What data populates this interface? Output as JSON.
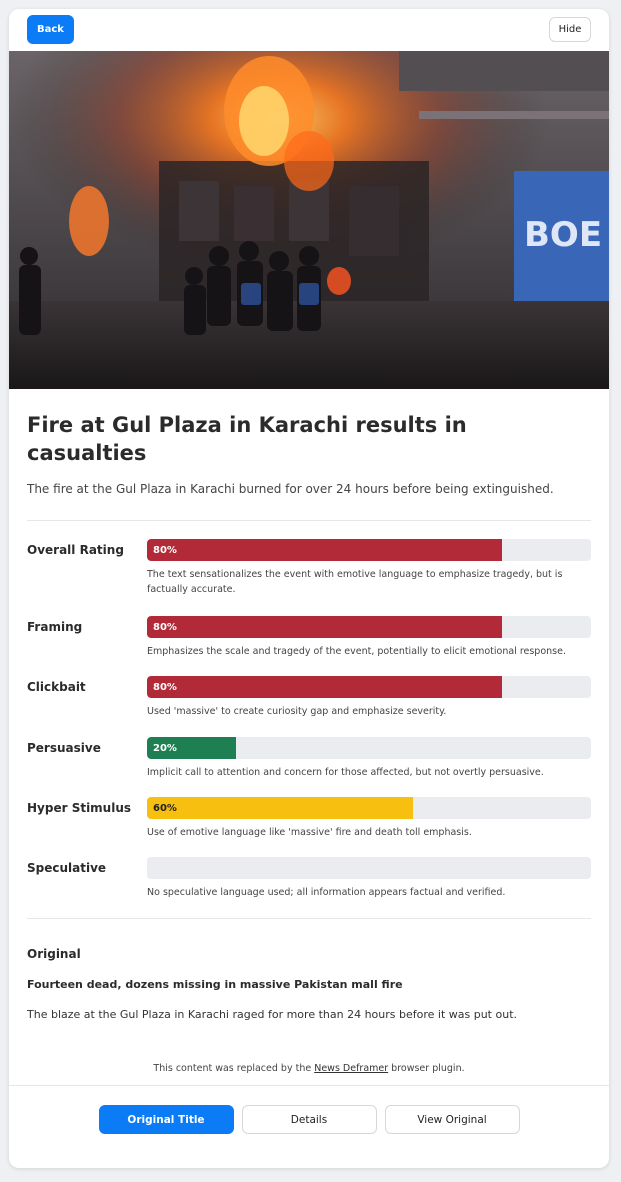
{
  "header": {
    "back_label": "Back",
    "hide_label": "Hide"
  },
  "article": {
    "title": "Fire at Gul Plaza in Karachi results in casualties",
    "subtitle": "The fire at the Gul Plaza in Karachi burned for over 24 hours before being extinguished.",
    "image_alt": "Firefighters and people at a burning building at night",
    "image_sign_text": "BOE"
  },
  "colors": {
    "red": "#b22a37",
    "green": "#1e8052",
    "yellow": "#f7bf0f",
    "track": "#ebecef",
    "accent": "#0b7cf5"
  },
  "metrics": [
    {
      "label": "Overall Rating",
      "percent": 80,
      "value_text": "80%",
      "color": "red",
      "desc": "The text sensationalizes the event with emotive language to emphasize tragedy, but is factually accurate."
    },
    {
      "label": "Framing",
      "percent": 80,
      "value_text": "80%",
      "color": "red",
      "desc": "Emphasizes the scale and tragedy of the event, potentially to elicit emotional response."
    },
    {
      "label": "Clickbait",
      "percent": 80,
      "value_text": "80%",
      "color": "red",
      "desc": "Used 'massive' to create curiosity gap and emphasize severity."
    },
    {
      "label": "Persuasive",
      "percent": 20,
      "value_text": "20%",
      "color": "green",
      "desc": "Implicit call to attention and concern for those affected, but not overtly persuasive."
    },
    {
      "label": "Hyper Stimulus",
      "percent": 60,
      "value_text": "60%",
      "color": "yellow",
      "desc": "Use of emotive language like 'massive' fire and death toll emphasis."
    },
    {
      "label": "Speculative",
      "percent": 0,
      "value_text": "",
      "color": "none",
      "desc": "No speculative language used; all information appears factual and verified."
    }
  ],
  "original": {
    "heading": "Original",
    "title": "Fourteen dead, dozens missing in massive Pakistan mall fire",
    "text": "The blaze at the Gul Plaza in Karachi raged for more than 24 hours before it was put out."
  },
  "footnote": {
    "prefix": "This content was replaced by the ",
    "link": "News Deframer",
    "suffix": " browser plugin."
  },
  "actions": {
    "original_title": "Original Title",
    "details": "Details",
    "view_original": "View Original"
  }
}
